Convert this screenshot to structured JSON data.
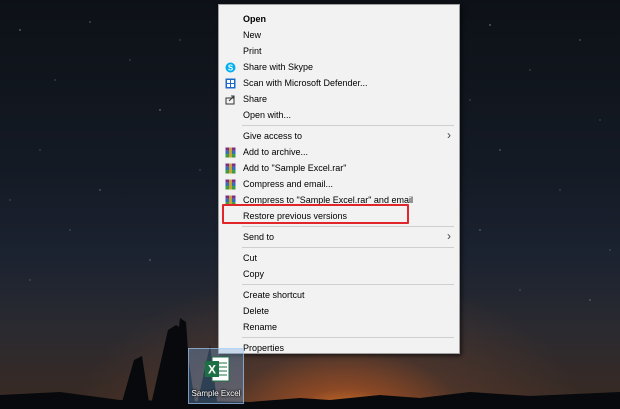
{
  "context_menu": {
    "items": [
      {
        "label": "Open",
        "icon": null
      },
      {
        "label": "New",
        "icon": null
      },
      {
        "label": "Print",
        "icon": null
      },
      {
        "label": "Share with Skype",
        "icon": "skype-icon"
      },
      {
        "label": "Scan with Microsoft Defender...",
        "icon": "defender-icon"
      },
      {
        "label": "Share",
        "icon": "share-icon"
      },
      {
        "label": "Open with...",
        "icon": null
      },
      {
        "label": "Give access to",
        "icon": null
      },
      {
        "label": "Add to archive...",
        "icon": "winrar-icon"
      },
      {
        "label": "Add to \"Sample Excel.rar\"",
        "icon": "winrar-icon"
      },
      {
        "label": "Compress and email...",
        "icon": "winrar-icon"
      },
      {
        "label": "Compress to \"Sample Excel.rar\" and email",
        "icon": "winrar-icon"
      },
      {
        "label": "Restore previous versions",
        "icon": null
      },
      {
        "label": "Send to",
        "icon": null
      },
      {
        "label": "Cut",
        "icon": null
      },
      {
        "label": "Copy",
        "icon": null
      },
      {
        "label": "Create shortcut",
        "icon": null
      },
      {
        "label": "Delete",
        "icon": null
      },
      {
        "label": "Rename",
        "icon": null
      },
      {
        "label": "Properties",
        "icon": null
      }
    ]
  },
  "desktop": {
    "file_label": "Sample Excel",
    "file_icon": "excel-file-icon",
    "file_icon_letter": "X"
  },
  "colors": {
    "highlight_border": "#e0262a",
    "excel_green": "#1d7044",
    "menu_background": "#f2f2f2"
  }
}
